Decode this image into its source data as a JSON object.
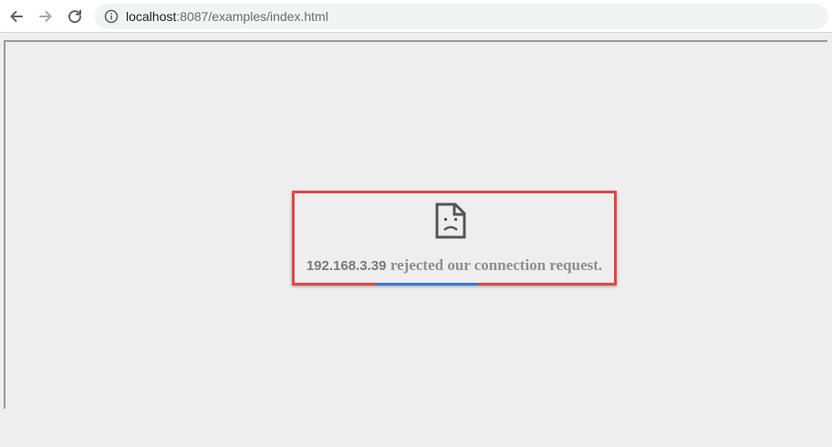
{
  "browser": {
    "nav": {
      "back_icon": "arrow-left-icon",
      "forward_icon": "arrow-right-icon",
      "reload_icon": "reload-icon"
    },
    "omnibox": {
      "security_icon": "info-icon",
      "url_host": "localhost",
      "url_rest": ":8087/examples/index.html"
    }
  },
  "error_page": {
    "icon": "sad-page-icon",
    "host": "192.168.3.39",
    "message": "rejected our connection request."
  },
  "colors": {
    "highlight": "#e24747",
    "page_background": "#eeeeee"
  }
}
